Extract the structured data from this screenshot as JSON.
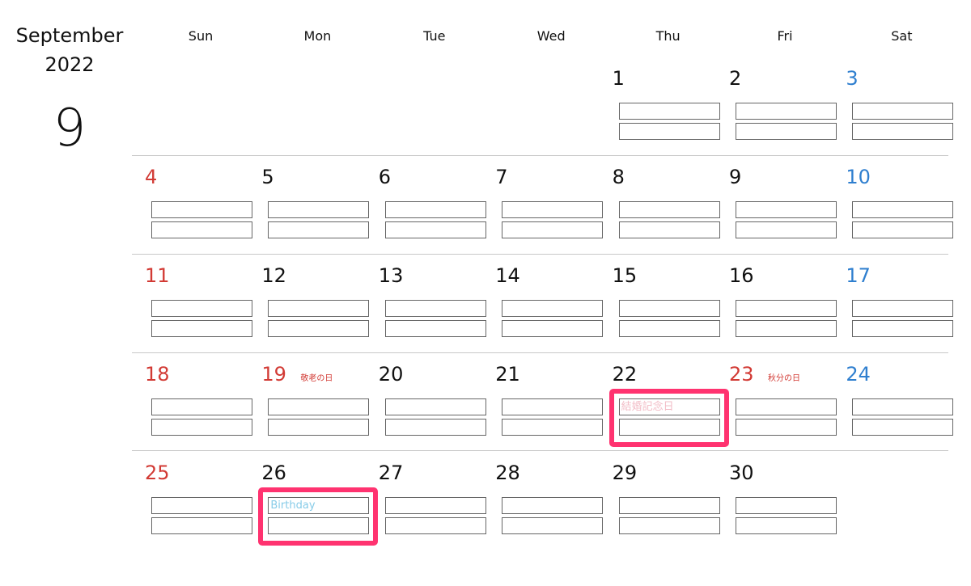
{
  "header": {
    "month_name": "September",
    "year": "2022",
    "month_number": "9"
  },
  "weekdays": [
    "Sun",
    "Mon",
    "Tue",
    "Wed",
    "Thu",
    "Fri",
    "Sat"
  ],
  "colors": {
    "sunday": "#d23a34",
    "saturday": "#2f7fcf",
    "weekday": "#111111",
    "highlight": "#ff3370",
    "event_pink": "#f2bcc6",
    "event_blue": "#86cbe8"
  },
  "weeks": [
    [
      null,
      null,
      null,
      null,
      "1",
      "2",
      "3"
    ],
    [
      "4",
      "5",
      "6",
      "7",
      "8",
      "9",
      "10"
    ],
    [
      "11",
      "12",
      "13",
      "14",
      "15",
      "16",
      "17"
    ],
    [
      "18",
      "19",
      "20",
      "21",
      "22",
      "23",
      "24"
    ],
    [
      "25",
      "26",
      "27",
      "28",
      "29",
      "30",
      null
    ]
  ],
  "holidays": {
    "19": "敬老の日",
    "23": "秋分の日"
  },
  "events": {
    "22": "結婚記念日",
    "26": "Birthday"
  },
  "highlighted_days": [
    "22",
    "26"
  ]
}
